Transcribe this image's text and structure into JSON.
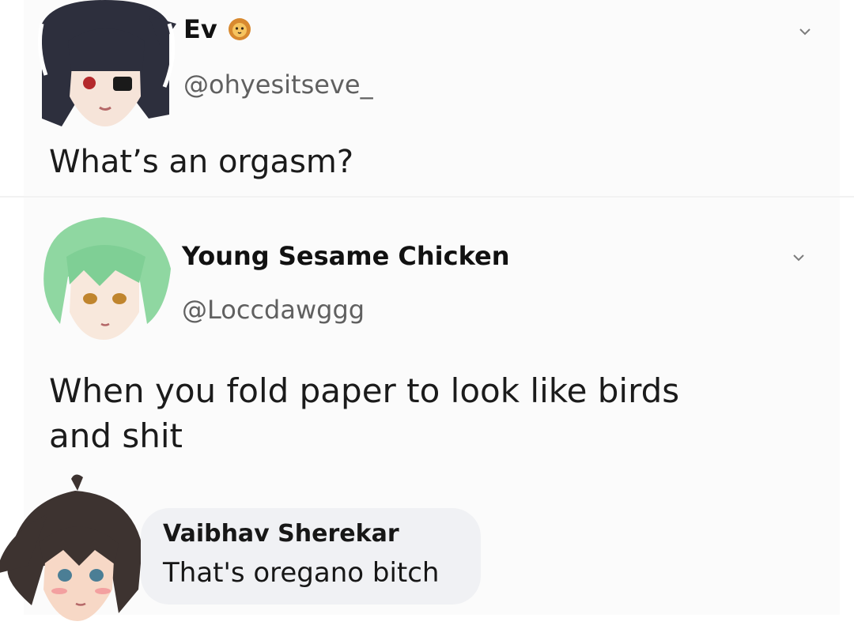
{
  "post": {
    "author_name": "Ev",
    "author_emoji": "lion-face-icon",
    "handle": "@ohyesitseve_",
    "text": "What’s an orgasm?"
  },
  "reply": {
    "author_name": "Young Sesame Chicken",
    "handle": "@Loccdawggg",
    "text_line1": "When you fold paper to look like birds",
    "text_line2": "and shit"
  },
  "comment": {
    "author_name": "Vaibhav Sherekar",
    "text": "That's oregano bitch"
  },
  "colors": {
    "background": "#ffffff",
    "bubble": "#f0f1f4",
    "handle": "#606060"
  }
}
